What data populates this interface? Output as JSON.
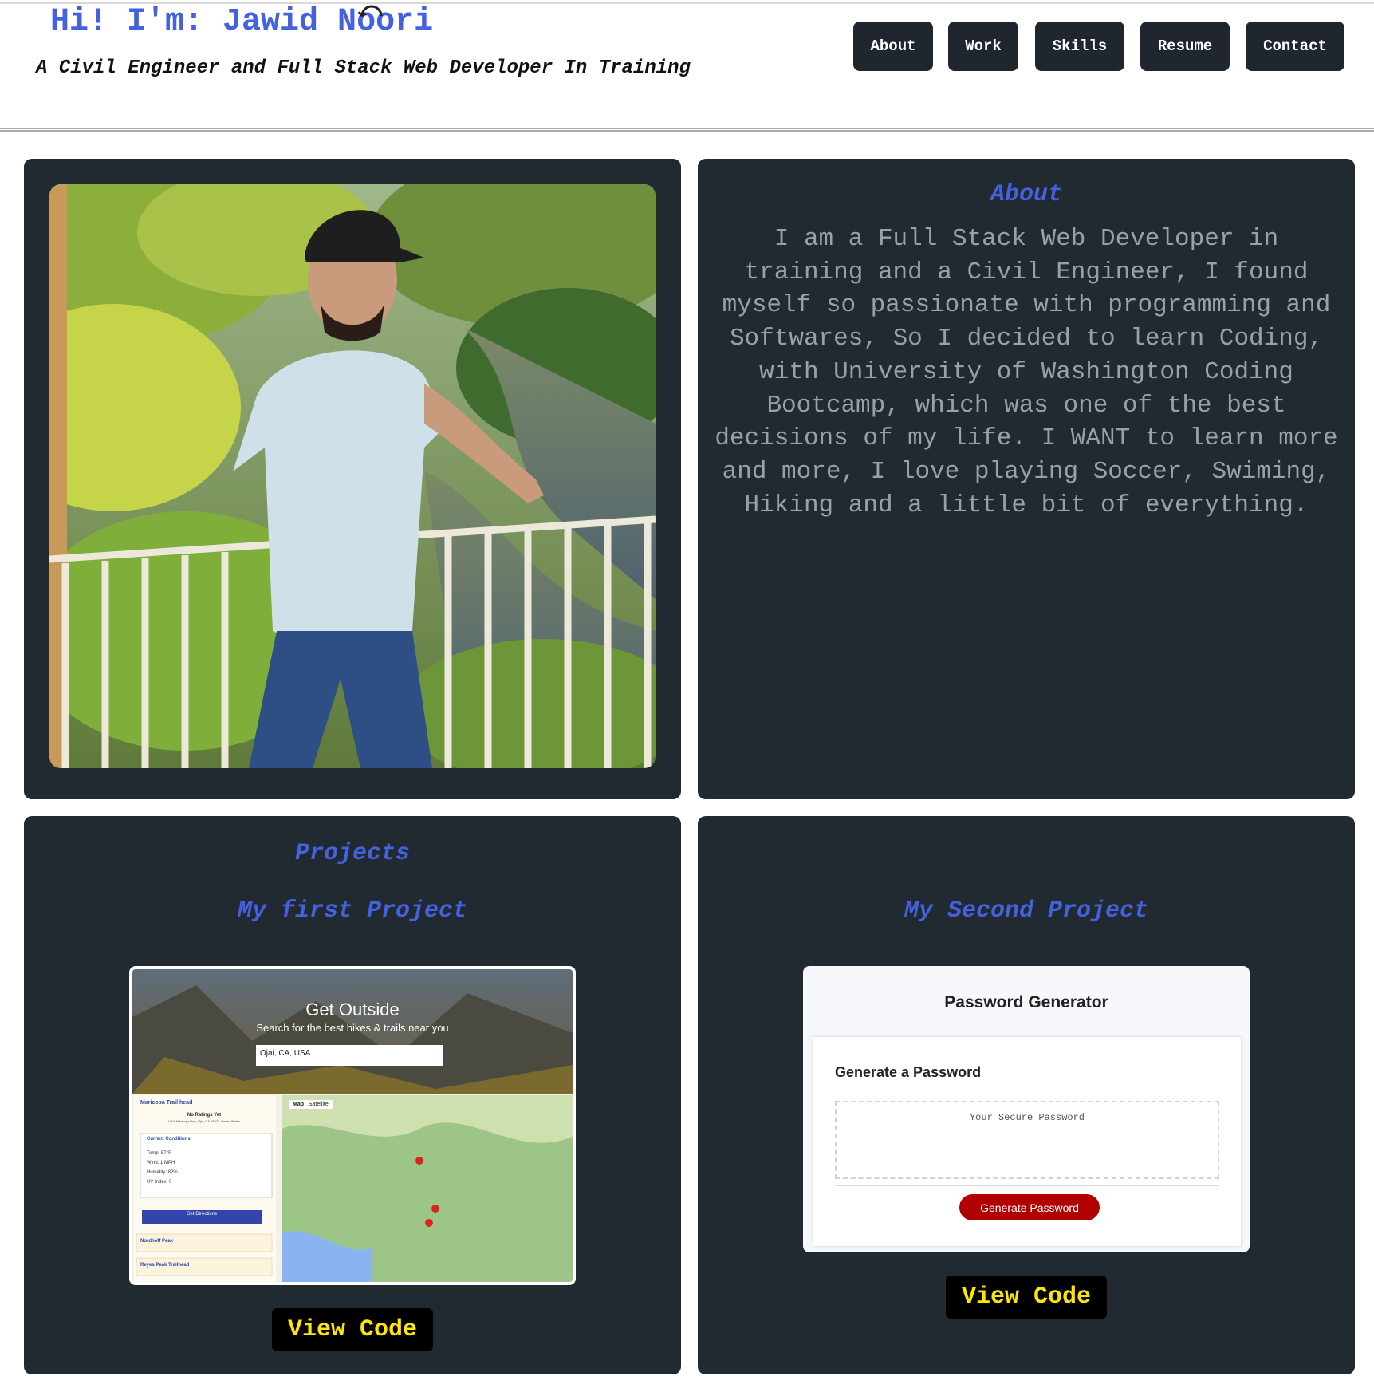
{
  "header": {
    "title": "Hi! I'm: Jawid Noori",
    "subtitle": "A Civil Engineer and Full Stack Web Developer In Training"
  },
  "nav": [
    {
      "label": "About"
    },
    {
      "label": "Work"
    },
    {
      "label": "Skills"
    },
    {
      "label": "Resume"
    },
    {
      "label": "Contact"
    }
  ],
  "about": {
    "heading": "About",
    "text": "I am a Full Stack Web Developer in training and a Civil Engineer, I found myself so passionate with programming and Softwares, So I decided to learn Coding, with University of Washington Coding Bootcamp, which was one of the best decisions of my life. I WANT to learn more and more, I love playing Soccer, Swiming, Hiking and a little bit of everything."
  },
  "projects": {
    "heading": "Projects",
    "first": {
      "title": "My first Project",
      "button": "View Code",
      "screenshot": {
        "hero_title": "Get Outside",
        "hero_sub": "Search for the best hikes & trails near you",
        "search_value": "Ojai, CA, USA",
        "trails": [
          "Maricopa Trail head",
          "Nordhoff Peak",
          "Reyes Peak Trailhead"
        ],
        "rating": "No Ratings Yet",
        "address": "1601 Maricopa Hwy, Ojai, CA 93023, United States",
        "conditions_title": "Current Conditions",
        "conditions": [
          "Temp: 57°F",
          "Wind: 1 MPH",
          "Humidity: 82%",
          "UV Index: 0"
        ],
        "directions_btn": "Get Directions",
        "map_tabs": [
          "Map",
          "Satellite"
        ]
      }
    },
    "second": {
      "title": "My Second Project",
      "button": "View Code",
      "screenshot": {
        "app_title": "Password Generator",
        "card_title": "Generate a Password",
        "placeholder": "Your Secure Password",
        "button": "Generate Password"
      }
    }
  },
  "colors": {
    "accent": "#4462e0",
    "card_bg": "#212931",
    "nav_bg": "#1f262d",
    "view_code_text": "#ffe600"
  }
}
